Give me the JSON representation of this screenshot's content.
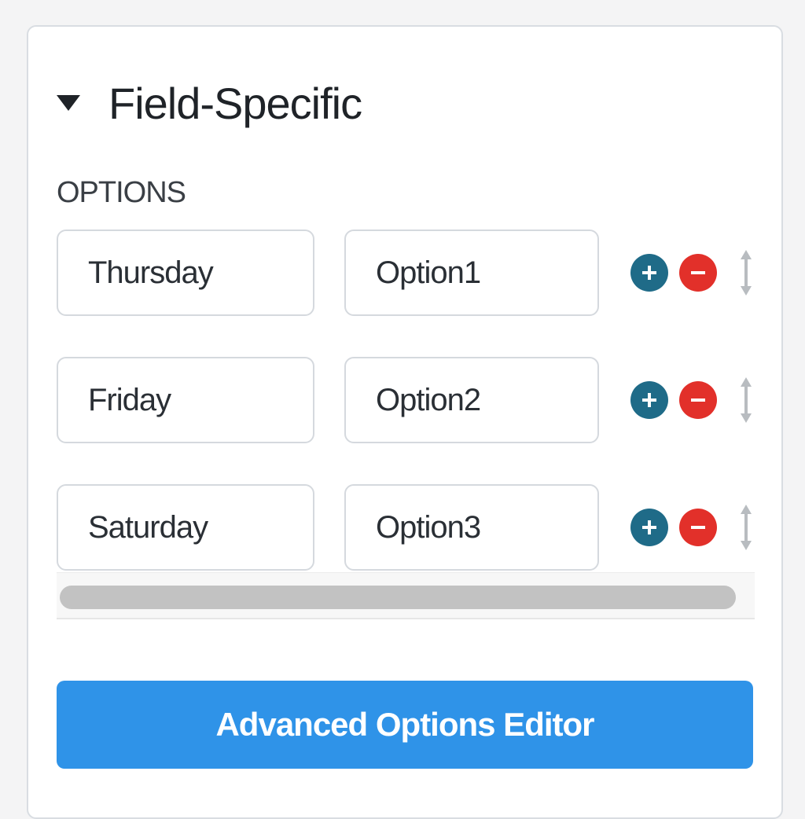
{
  "section": {
    "title": "Field-Specific",
    "expanded": true
  },
  "options": {
    "heading": "OPTIONS",
    "rows": [
      {
        "label": "Thursday",
        "value": "Option1"
      },
      {
        "label": "Friday",
        "value": "Option2"
      },
      {
        "label": "Saturday",
        "value": "Option3"
      }
    ]
  },
  "advanced_button": {
    "label": "Advanced Options Editor"
  },
  "icons": {
    "collapse": "caret-down-icon",
    "add": "plus-circle-icon",
    "remove": "minus-circle-icon",
    "reorder": "drag-handle-icon"
  },
  "colors": {
    "accent": "#2f93e8",
    "add": "#1f6b88",
    "remove": "#e2302a"
  }
}
